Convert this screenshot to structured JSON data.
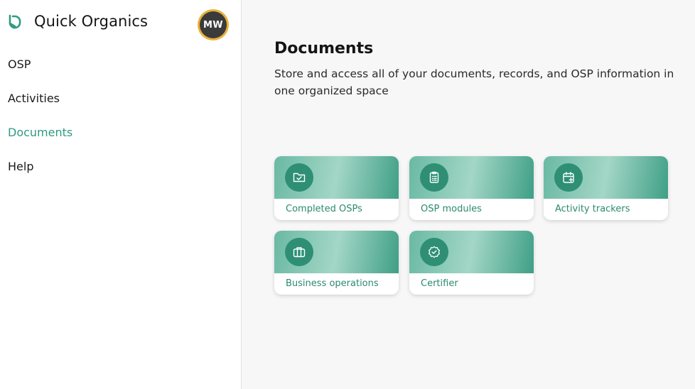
{
  "brand": {
    "name": "Quick Organics",
    "accent": "#2f9b7f"
  },
  "user": {
    "initials": "MW"
  },
  "nav": {
    "items": [
      {
        "label": "OSP",
        "active": false
      },
      {
        "label": "Activities",
        "active": false
      },
      {
        "label": "Documents",
        "active": true
      },
      {
        "label": "Help",
        "active": false
      }
    ]
  },
  "main": {
    "title": "Documents",
    "description": "Store and access all of your documents, records, and OSP information in one organized space",
    "cards": [
      {
        "label": "Completed OSPs",
        "icon": "folder-check-icon"
      },
      {
        "label": "OSP modules",
        "icon": "clipboard-list-icon"
      },
      {
        "label": "Activity trackers",
        "icon": "calendar-plus-icon"
      },
      {
        "label": "Business operations",
        "icon": "briefcase-icon"
      },
      {
        "label": "Certifier",
        "icon": "badge-check-icon"
      }
    ]
  },
  "colors": {
    "accent": "#2f9b7f",
    "card_icon_bg": "#2e8f74",
    "avatar_ring": "#e8b23c"
  }
}
